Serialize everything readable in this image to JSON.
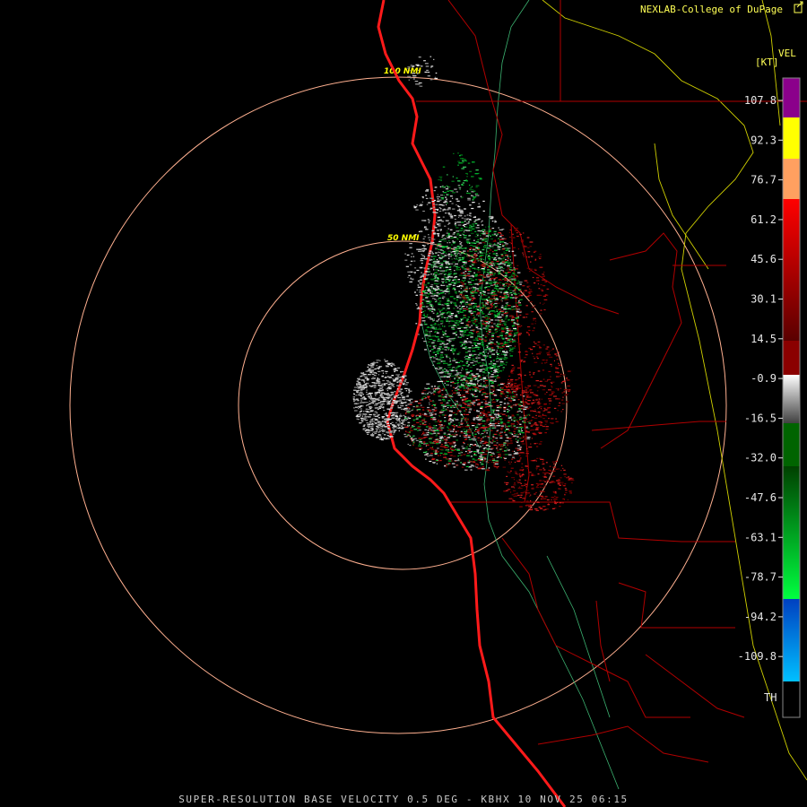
{
  "credit": "NEXLAB-College of DuPage",
  "credit_icon": "external-link-icon",
  "caption": "SUPER-RESOLUTION BASE VELOCITY 0.5 DEG - KBHX 10 NOV 25 06:15",
  "legend": {
    "title": "VEL",
    "unit": "[KT]",
    "ticks": [
      "107.8",
      "92.3",
      "76.7",
      "61.2",
      "45.6",
      "30.1",
      "14.5",
      "-0.9",
      "-16.5",
      "-32.0",
      "-47.6",
      "-63.1",
      "-78.7",
      "-94.2",
      "-109.8"
    ],
    "bottom_label": "TH",
    "colors": {
      "purple": "#8b008b",
      "yellow": "#ffff00",
      "orange": "#ffa060",
      "red": "#ff0000",
      "darkred": "#8b0000",
      "gray": "#c8c8c8",
      "darkgreen": "#006400",
      "green": "#00ff40",
      "blue": "#0050ff",
      "cyan": "#00aaff",
      "black": "#1a001a"
    }
  },
  "range_rings": [
    "50 NMI",
    "100 NMI"
  ],
  "map_colors": {
    "ring": "#ffb090",
    "coast": "#ff1a1a",
    "state": "#b00000",
    "county": "#c00000",
    "highway": "#e6e600",
    "river": "#3cb371"
  }
}
